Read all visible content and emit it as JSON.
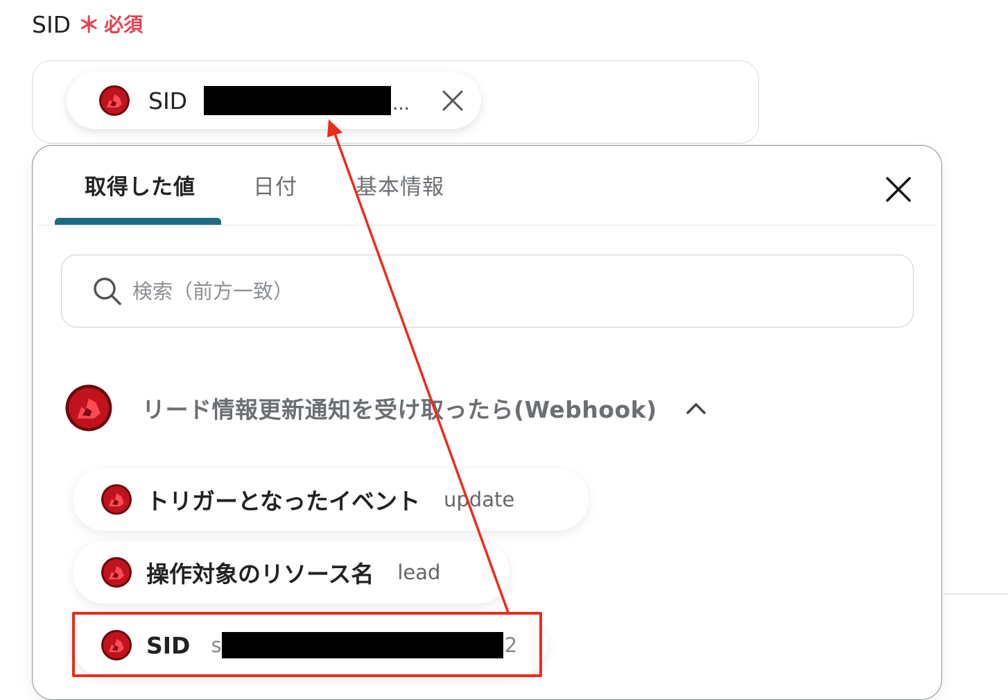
{
  "field": {
    "label": "SID",
    "required_mark": "＊",
    "required_text": "必須"
  },
  "selected_chip": {
    "label": "SID",
    "ellipsis": "..."
  },
  "tabs": [
    {
      "label": "取得した値",
      "active": true
    },
    {
      "label": "日付",
      "active": false
    },
    {
      "label": "基本情報",
      "active": false
    }
  ],
  "search": {
    "placeholder": "検索（前方一致）"
  },
  "section": {
    "title": "リード情報更新通知を受け取ったら(Webhook)"
  },
  "items": [
    {
      "label": "トリガーとなったイベント",
      "value": "update"
    },
    {
      "label": "操作対象のリソース名",
      "value": "lead"
    },
    {
      "label": "SID",
      "value_head": "s",
      "value_tail": "2"
    }
  ],
  "colors": {
    "required": "#e8414f",
    "tab_underline": "#1d6a83",
    "annotation": "#ec2b1a",
    "avatar": "#c0131d"
  },
  "icons": {
    "avatar": "app-avatar-icon",
    "close": "close-icon",
    "search": "search-icon",
    "chevron": "chevron-up-icon"
  }
}
